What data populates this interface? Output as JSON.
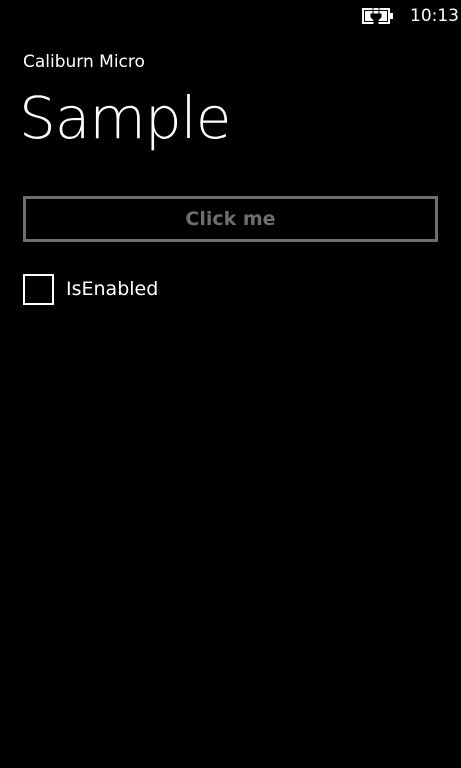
{
  "status_bar": {
    "time": "10:13",
    "battery_icon": "battery-charging-icon"
  },
  "header": {
    "app_title": "Caliburn Micro",
    "page_title": "Sample"
  },
  "main": {
    "button_label": "Click me",
    "button_enabled": false,
    "checkbox_label": "IsEnabled",
    "checkbox_checked": false
  },
  "colors": {
    "background": "#000000",
    "foreground": "#ffffff",
    "disabled": "#6e6e6e"
  }
}
